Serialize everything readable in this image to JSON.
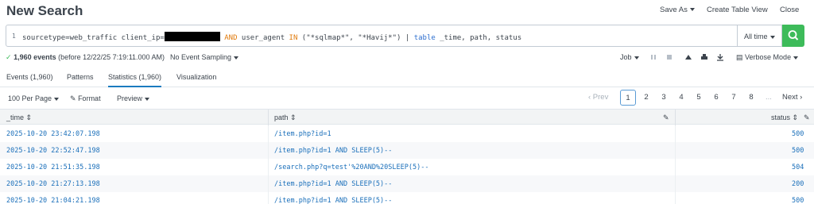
{
  "header": {
    "title": "New Search",
    "save_as": "Save As",
    "create_table_view": "Create Table View",
    "close": "Close"
  },
  "search": {
    "line_number": "1",
    "q_part1": "sourcetype=web_traffic client_ip=",
    "q_and": "AND",
    "q_field": "user_agent",
    "q_in": "IN",
    "q_values": "(\"*sqlmap*\", \"*Havij*\")",
    "q_pipe": "|",
    "q_cmd": "table",
    "q_fields": "_time, path, status",
    "time_range": "All time"
  },
  "status": {
    "event_count": "1,960 events",
    "before": "(before 12/22/25 7:19:11.000 AM)",
    "sampling": "No Event Sampling",
    "job": "Job",
    "mode": "Verbose Mode"
  },
  "tabs": [
    {
      "label": "Events (1,960)"
    },
    {
      "label": "Patterns"
    },
    {
      "label": "Statistics (1,960)"
    },
    {
      "label": "Visualization"
    }
  ],
  "controls": {
    "per_page": "100 Per Page",
    "format": "Format",
    "preview": "Preview",
    "prev": "‹ Prev",
    "next": "Next ›",
    "pages": [
      "1",
      "2",
      "3",
      "4",
      "5",
      "6",
      "7",
      "8",
      "..."
    ]
  },
  "table": {
    "headers": [
      "_time",
      "path",
      "status"
    ],
    "rows": [
      {
        "time": "2025-10-20 23:42:07.198",
        "path": "/item.php?id=1",
        "status": "500"
      },
      {
        "time": "2025-10-20 22:52:47.198",
        "path": "/item.php?id=1 AND SLEEP(5)--",
        "status": "500"
      },
      {
        "time": "2025-10-20 21:51:35.198",
        "path": "/search.php?q=test'%20AND%20SLEEP(5)--",
        "status": "504"
      },
      {
        "time": "2025-10-20 21:27:13.198",
        "path": "/item.php?id=1 AND SLEEP(5)--",
        "status": "200"
      },
      {
        "time": "2025-10-20 21:04:21.198",
        "path": "/item.php?id=1 AND SLEEP(5)--",
        "status": "500"
      }
    ]
  },
  "colors": {
    "accent": "#1a7bbf",
    "go_button": "#3dbb5a",
    "link": "#1a6fba",
    "operator": "#e07a0c"
  }
}
